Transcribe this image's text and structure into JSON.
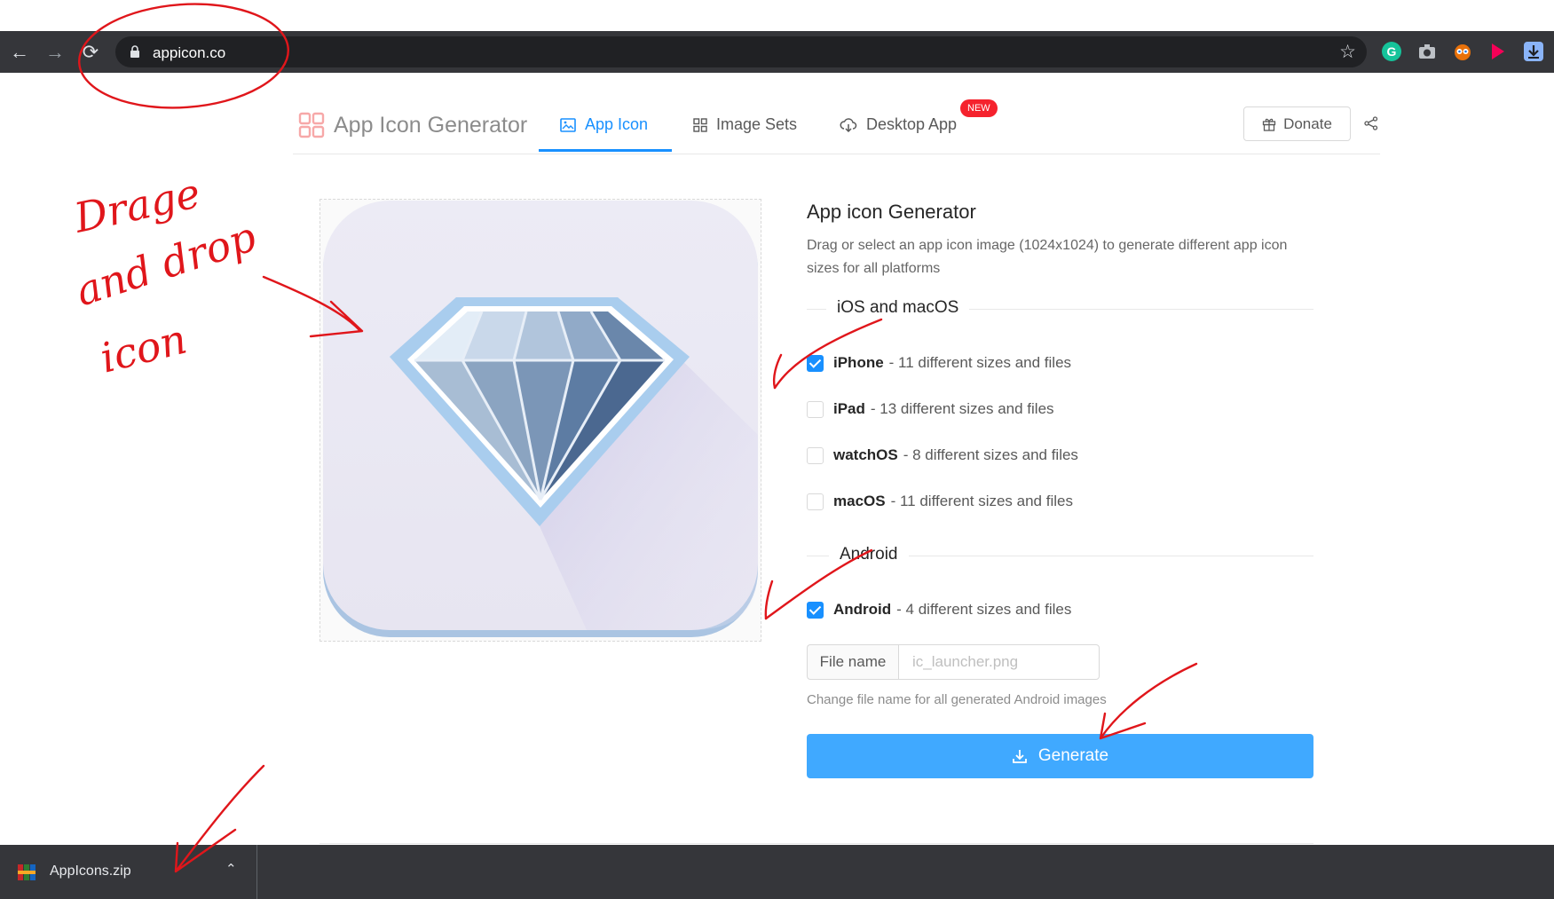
{
  "browser": {
    "url": "appicon.co",
    "nav": {
      "back": "←",
      "forward": "→",
      "reload": "⟳"
    },
    "bookmark_icon": "star-icon",
    "extensions": [
      "grammarly-icon",
      "camera-icon",
      "owl-icon",
      "flag-icon",
      "download-ext-icon"
    ]
  },
  "header": {
    "brand": "App Icon Generator",
    "tabs": [
      {
        "label": "App Icon",
        "icon": "image-icon",
        "active": true
      },
      {
        "label": "Image Sets",
        "icon": "grid-icon",
        "active": false
      },
      {
        "label": "Desktop App",
        "icon": "cloud-download-icon",
        "active": false
      }
    ],
    "new_badge": "NEW",
    "donate": "Donate"
  },
  "panel": {
    "title": "App icon Generator",
    "description": "Drag or select an app icon image (1024x1024) to generate different app icon sizes for all platforms",
    "ios_section": "iOS and macOS",
    "android_section": "Android",
    "options": [
      {
        "name": "iPhone",
        "desc": "- 11 different sizes and files",
        "checked": true
      },
      {
        "name": "iPad",
        "desc": "- 13 different sizes and files",
        "checked": false
      },
      {
        "name": "watchOS",
        "desc": "- 8 different sizes and files",
        "checked": false
      },
      {
        "name": "macOS",
        "desc": "- 11 different sizes and files",
        "checked": false
      },
      {
        "name": "Android",
        "desc": "- 4 different sizes and files",
        "checked": true
      }
    ],
    "file_name_label": "File name",
    "file_name_placeholder": "ic_launcher.png",
    "file_name_help": "Change file name for all generated Android images",
    "generate": "Generate"
  },
  "download": {
    "filename": "AppIcons.zip",
    "chevron": "⌃"
  },
  "colors": {
    "primary": "#1890ff",
    "generate": "#40a9ff",
    "chrome": "#35363a",
    "annotation": "#e0161b"
  },
  "annotations": {
    "handwriting": [
      "Drage",
      "and drop",
      "icon"
    ]
  }
}
